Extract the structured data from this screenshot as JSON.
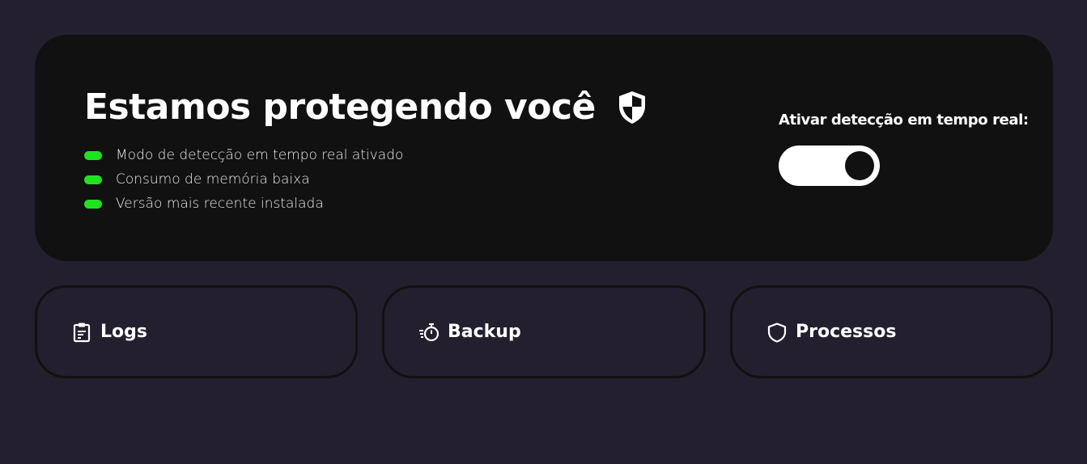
{
  "hero": {
    "title": "Estamos protegendo você",
    "title_icon": "shield-halved-icon",
    "status_items": [
      {
        "label": "Modo de detecção em tempo real ativado",
        "color": "#1fe31f"
      },
      {
        "label": "Consumo de memória baixa",
        "color": "#1fe31f"
      },
      {
        "label": "Versão mais recente instalada",
        "color": "#1fe31f"
      }
    ],
    "toggle": {
      "label": "Ativar detecção em tempo real:",
      "state": "on"
    }
  },
  "cards": [
    {
      "label": "Logs",
      "icon": "clipboard-list-icon"
    },
    {
      "label": "Backup",
      "icon": "stopwatch-fast-icon"
    },
    {
      "label": "Processos",
      "icon": "shield-outline-icon"
    }
  ],
  "colors": {
    "background": "#231f2e",
    "panel": "#111111",
    "status_ok": "#1fe31f",
    "text": "#ffffff"
  }
}
